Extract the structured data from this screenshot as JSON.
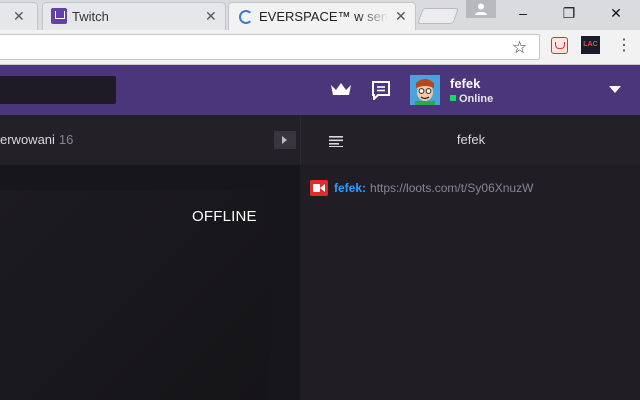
{
  "browser": {
    "tabs": [
      {
        "title": "",
        "favicon": "tab-icon"
      },
      {
        "title": "Twitch",
        "favicon": "twitch-icon"
      },
      {
        "title": "EVERSPACE™ w serwisie",
        "favicon": "loading-spinner-icon"
      }
    ],
    "window_controls": {
      "minimize": "–",
      "restore": "❐",
      "close": "✕"
    },
    "toolbar": {
      "bookmark_icon": "star-icon",
      "extensions": [
        {
          "name": "extension-icon"
        },
        {
          "name": "lac-extension-icon",
          "label": "LAC"
        }
      ],
      "menu_icon": "kebab-menu-icon"
    }
  },
  "twitch": {
    "header": {
      "user": {
        "name": "fefek",
        "status": "Online"
      },
      "icons": [
        "crown-icon",
        "whispers-icon",
        "avatar",
        "chevron-down-icon"
      ]
    },
    "left": {
      "reserved_label": "erwowani",
      "reserved_count": "16"
    },
    "player": {
      "offline_label": "OFFLINE"
    },
    "chat": {
      "title": "fefek",
      "messages": [
        {
          "user": "fefek",
          "text": "https://loots.com/t/Sy06XnuzW"
        }
      ]
    }
  },
  "colors": {
    "twitch_purple": "#4b367c",
    "chat_user": "#2e9cff",
    "online_green": "#1ed760",
    "badge_red": "#e02b2b"
  }
}
